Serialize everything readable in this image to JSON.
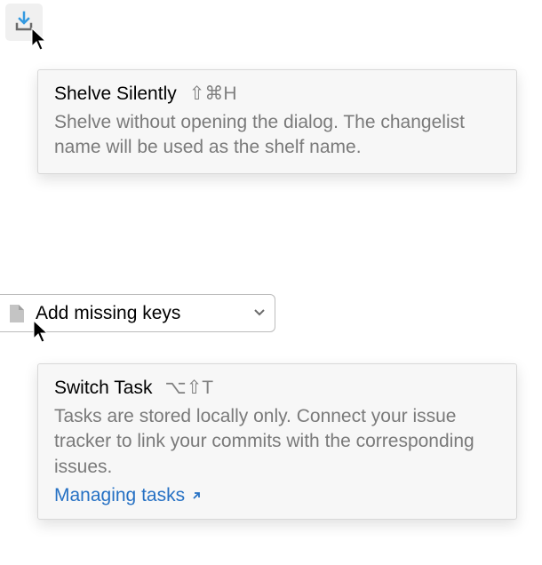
{
  "section1": {
    "tooltip": {
      "title": "Shelve Silently",
      "shortcut": "⇧⌘H",
      "description": "Shelve without opening the dialog. The changelist name will be used as the shelf name."
    }
  },
  "section2": {
    "dropdown": {
      "label": "Add missing keys"
    },
    "tooltip": {
      "title": "Switch Task",
      "shortcut": "⌥⇧T",
      "description": "Tasks are stored locally only. Connect your issue tracker to link your commits with the corresponding issues.",
      "link": "Managing tasks"
    }
  }
}
